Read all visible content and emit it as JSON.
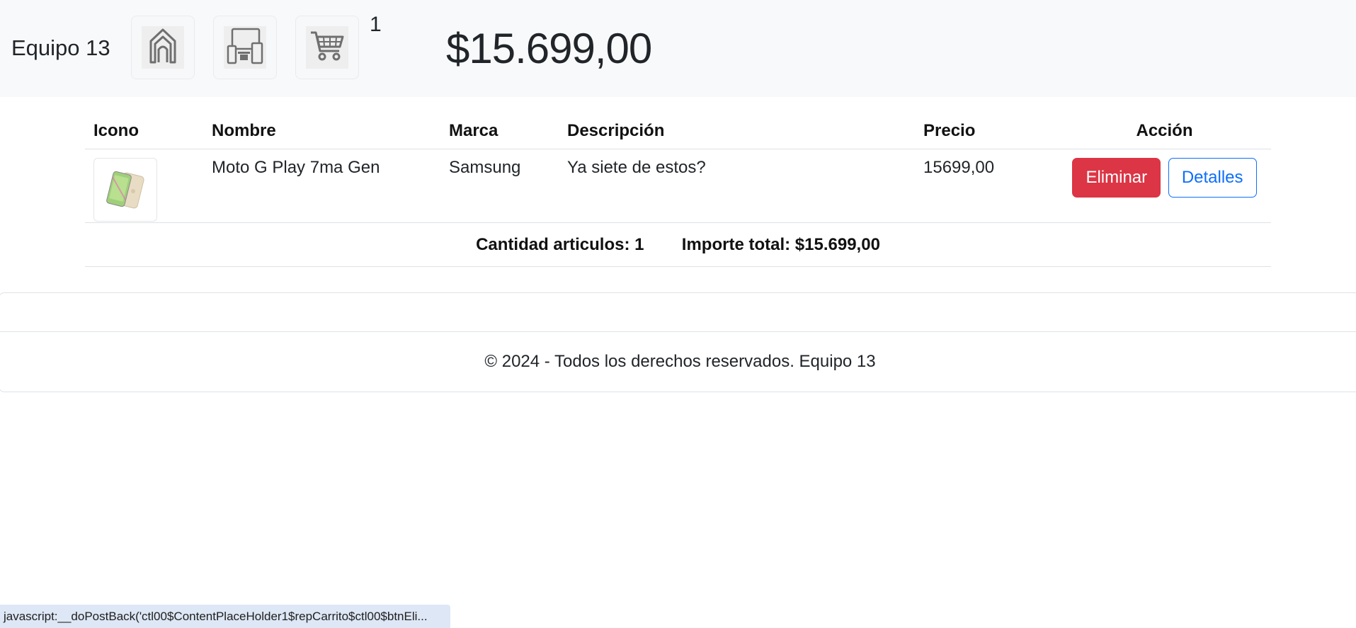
{
  "navbar": {
    "brand": "Equipo 13",
    "home_icon": "home-icon",
    "catalog_icon": "devices-icon",
    "cart_icon": "shopping-cart-icon",
    "cart_count": "1",
    "cart_total": "$15.699,00"
  },
  "table": {
    "headers": {
      "icon": "Icono",
      "name": "Nombre",
      "brand": "Marca",
      "description": "Descripción",
      "price": "Precio",
      "action": "Acción"
    },
    "rows": [
      {
        "image": "phone-image",
        "name": "Moto G Play 7ma Gen",
        "brand": "Samsung",
        "description": "Ya siete de estos?",
        "price": "15699,00",
        "delete_label": "Eliminar",
        "details_label": "Detalles"
      }
    ],
    "totals": {
      "quantity": "Cantidad articulos: 1",
      "amount": "Importe total: $15.699,00"
    }
  },
  "footer": {
    "text": "© 2024 - Todos los derechos reservados. Equipo 13"
  },
  "statusbar": {
    "text": "javascript:__doPostBack('ctl00$ContentPlaceHolder1$repCarrito$ctl00$btnEli..."
  },
  "colors": {
    "navbar_bg": "#f8f9fa",
    "danger": "#dc3545",
    "primary": "#0d6efd",
    "statusbar_bg": "#dee7f5"
  }
}
